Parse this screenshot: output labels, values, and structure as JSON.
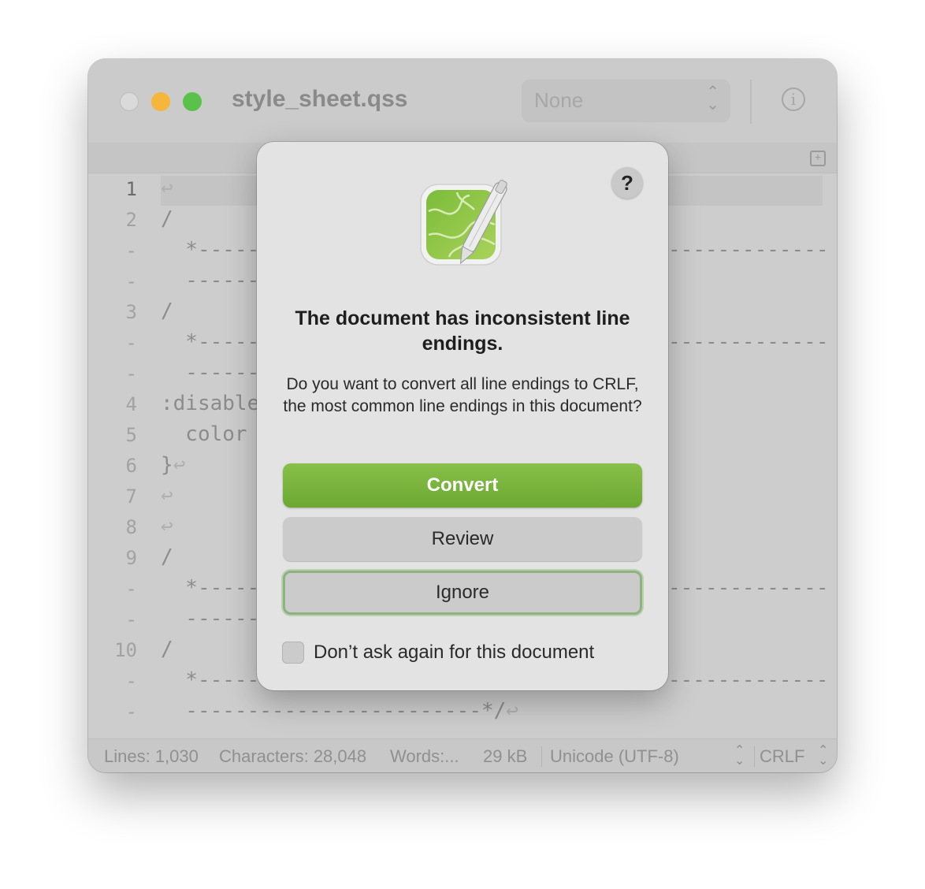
{
  "window": {
    "title": "style_sheet.qss",
    "syntax_popup_value": "None",
    "info_icon": "info-icon",
    "split_icon": "split-editor-icon"
  },
  "editor": {
    "lines": [
      {
        "num": "1",
        "text": "",
        "eol": "↩"
      },
      {
        "num": "2",
        "text": "/",
        "eol": ""
      },
      {
        "num": "-",
        "text": "  *-------",
        "right": "-------------",
        "eol": ""
      },
      {
        "num": "-",
        "text": "  ------",
        "eol": ""
      },
      {
        "num": "3",
        "text": "/",
        "eol": ""
      },
      {
        "num": "-",
        "text": "  *-------",
        "right": "-------------",
        "eol": ""
      },
      {
        "num": "-",
        "text": "  ------",
        "eol": ""
      },
      {
        "num": "4",
        "text": ":disable",
        "eol": ""
      },
      {
        "num": "5",
        "text": "  color",
        "eol": ""
      },
      {
        "num": "6",
        "text": "}",
        "eol": "↩"
      },
      {
        "num": "7",
        "text": "",
        "eol": "↩"
      },
      {
        "num": "8",
        "text": "",
        "eol": "↩"
      },
      {
        "num": "9",
        "text": "/",
        "eol": ""
      },
      {
        "num": "-",
        "text": "  *-------",
        "right": "-------------",
        "eol": ""
      },
      {
        "num": "-",
        "text": "  ------",
        "eol": ""
      },
      {
        "num": "10",
        "text": "/",
        "eol": ""
      },
      {
        "num": "-",
        "text": "  *-------",
        "right": "-------------",
        "eol": ""
      },
      {
        "num": "-",
        "text": "  ------------------------*/",
        "eol": "↩"
      }
    ]
  },
  "status": {
    "lines": "Lines: 1,030",
    "characters": "Characters: 28,048",
    "words": "Words:...",
    "size": "29 kB",
    "encoding": "Unicode (UTF-8)",
    "line_ending": "CRLF"
  },
  "dialog": {
    "help_label": "?",
    "title": "The document has inconsistent line endings.",
    "message": "Do you want to convert all line endings to CRLF, the most common line endings in this document?",
    "convert_label": "Convert",
    "review_label": "Review",
    "ignore_label": "Ignore",
    "checkbox_label": "Don’t ask again for this document",
    "accent_color": "#79b63f"
  }
}
